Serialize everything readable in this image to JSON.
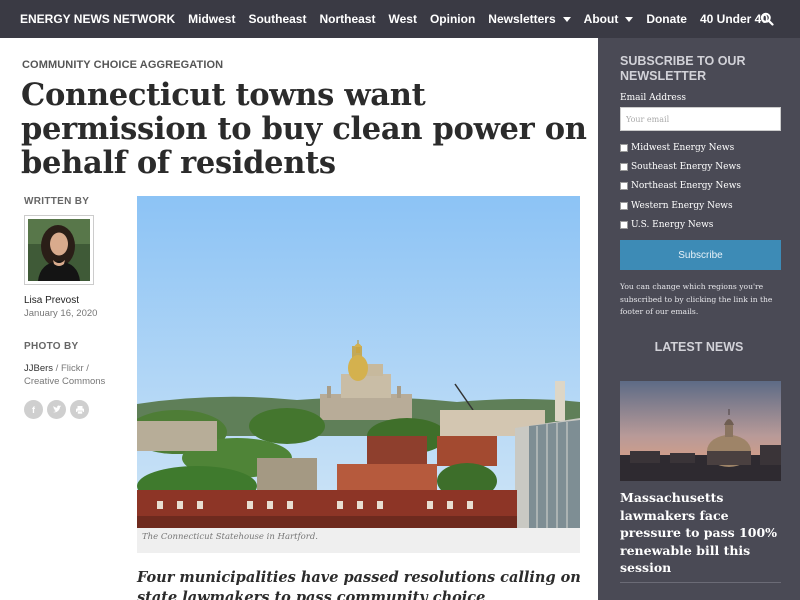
{
  "nav": {
    "brand": "ENERGY NEWS NETWORK",
    "items": [
      {
        "label": "Midwest"
      },
      {
        "label": "Southeast"
      },
      {
        "label": "Northeast"
      },
      {
        "label": "West"
      },
      {
        "label": "Opinion"
      },
      {
        "label": "Newsletters"
      },
      {
        "label": "About"
      },
      {
        "label": "Donate"
      },
      {
        "label": "40 Under 40"
      }
    ],
    "search_icon": "search-icon"
  },
  "article": {
    "category": "COMMUNITY CHOICE AGGREGATION",
    "headline": "Connecticut towns want permission to buy clean power on behalf of residents",
    "written_by_label": "WRITTEN BY",
    "author": "Lisa Prevost",
    "date": "January 16, 2020",
    "photo_by_label": "PHOTO BY",
    "photo_credit": {
      "name": "JJBers",
      "sep1": " / ",
      "source": "Flickr",
      "sep2": " /",
      "license": "Creative Commons"
    },
    "share_icons": [
      "facebook-icon",
      "twitter-icon",
      "print-icon"
    ],
    "caption": "The Connecticut Statehouse in Hartford.",
    "dek": "Four municipalities have passed resolutions calling on state lawmakers to pass community choice aggregation"
  },
  "sidebar": {
    "newsletter_heading": "SUBSCRIBE TO OUR NEWSLETTER",
    "email_label": "Email Address",
    "email_placeholder": "Your email",
    "email_value": "",
    "options": [
      {
        "label": "Midwest Energy News"
      },
      {
        "label": "Southeast Energy News"
      },
      {
        "label": "Northeast Energy News"
      },
      {
        "label": "Western Energy News"
      },
      {
        "label": "U.S. Energy News"
      }
    ],
    "subscribe_label": "Subscribe",
    "note": "You can change which regions you're subscribed to by clicking the link in the footer of our emails.",
    "latest_heading": "LATEST NEWS",
    "latest_story": "Massachusetts lawmakers face pressure to pass 100% renewable bill this session"
  },
  "colors": {
    "nav_bg": "#3a3a44",
    "sidebar_bg": "#4a4a55",
    "subscribe_bg": "#3d8bb6"
  }
}
